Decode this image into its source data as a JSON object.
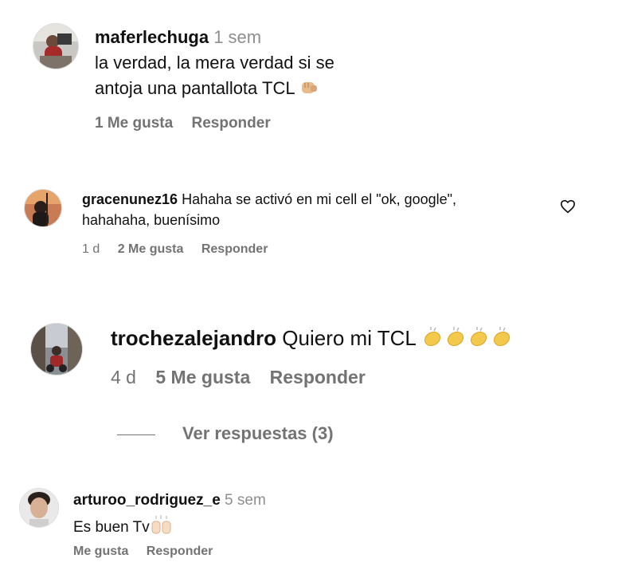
{
  "comments": [
    {
      "username": "maferlechuga",
      "time": "1 sem",
      "text_line1": "la verdad, la mera verdad si se",
      "text_line2": "antoja una pantallota TCL",
      "emoji": "fist-bump-emoji",
      "likes": "1 Me gusta",
      "reply": "Responder"
    },
    {
      "username": "gracenunez16",
      "text_line1": "Hahaha se activó en mi cell el \"ok, google\",",
      "text_line2": "hahahaha, buenísimo",
      "time": "1 d",
      "likes": "2 Me gusta",
      "reply": "Responder",
      "like_icon": "heart-outline-icon"
    },
    {
      "username": "trochezalejandro",
      "text": "Quiero mi TCL",
      "emoji": "clapping-hands-emoji",
      "time": "4 d",
      "likes": "5 Me gusta",
      "reply": "Responder",
      "view_replies": "Ver respuestas (3)"
    },
    {
      "username": "arturoo_rodriguez_e",
      "time": "5 sem",
      "text": "Es buen Tv",
      "emoji": "raising-hands-emoji",
      "likes": "Me gusta",
      "reply": "Responder"
    }
  ],
  "colors": {
    "text": "#111111",
    "secondary": "#737373",
    "time": "#8e8e8e",
    "emoji_skin": "#f0c27a"
  }
}
